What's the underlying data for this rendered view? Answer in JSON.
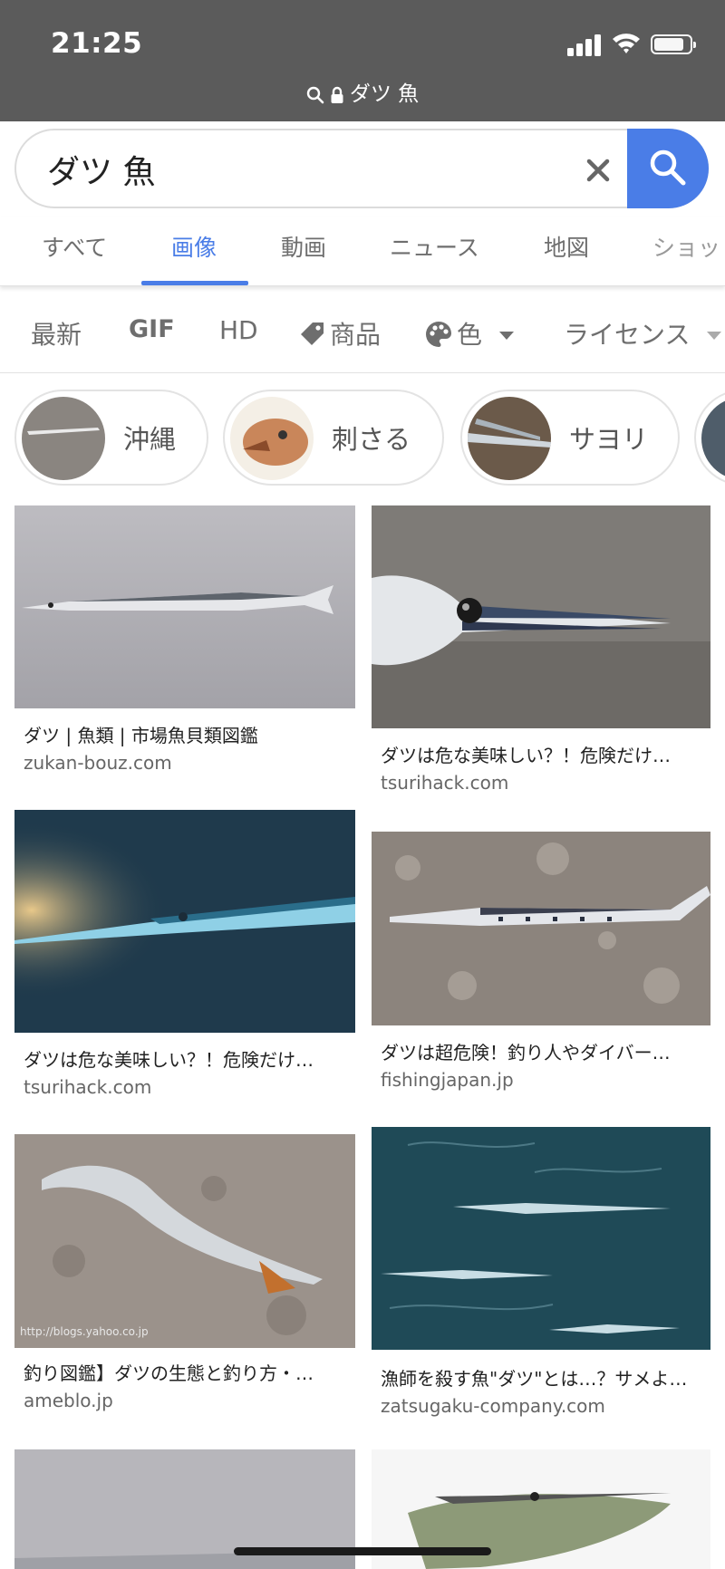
{
  "status_bar": {
    "time": "21:25"
  },
  "url_bar": {
    "text": "ダツ 魚"
  },
  "search": {
    "query": "ダツ 魚"
  },
  "tabs": [
    {
      "label": "すべて",
      "active": false
    },
    {
      "label": "画像",
      "active": true
    },
    {
      "label": "動画",
      "active": false
    },
    {
      "label": "ニュース",
      "active": false
    },
    {
      "label": "地図",
      "active": false
    },
    {
      "label": "ショッ",
      "active": false
    }
  ],
  "filters": {
    "latest": "最新",
    "gif": "GIF",
    "hd": "HD",
    "products": "商品",
    "color": "色",
    "license": "ライセンス"
  },
  "chips": [
    {
      "label": "沖縄"
    },
    {
      "label": "刺さる"
    },
    {
      "label": "サヨリ"
    }
  ],
  "results": [
    {
      "title": "ダツ | 魚類 | 市場魚貝類図鑑",
      "domain": "zukan-bouz.com"
    },
    {
      "title": "ダツは危な美味しい？！危険だけ…",
      "domain": "tsurihack.com"
    },
    {
      "title": "ダツは危な美味しい？！危険だけ…",
      "domain": "tsurihack.com"
    },
    {
      "title": "ダツは超危険！釣り人やダイバー…",
      "domain": "fishingjapan.jp"
    },
    {
      "title": "釣り図鑑】ダツの生態と釣り方・…",
      "domain": "ameblo.jp"
    },
    {
      "title": "漁師を殺す魚\"ダツ\"とは…？サメよ…",
      "domain": "zatsugaku-company.com"
    }
  ],
  "colors": {
    "accent": "#4a7de7",
    "status_bar_bg": "#5b5b5b"
  },
  "battery_level": 0.85
}
